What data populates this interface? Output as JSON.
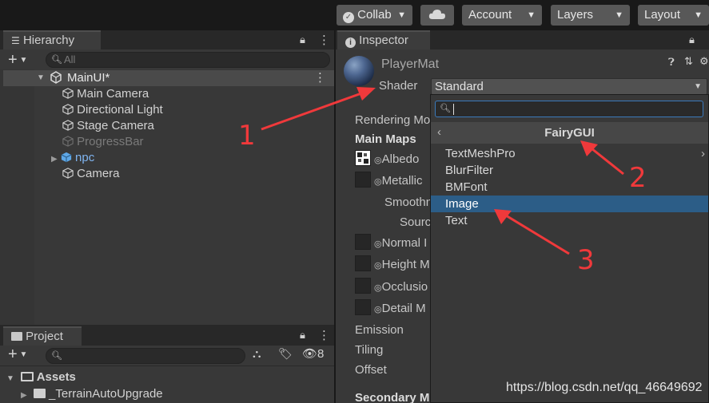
{
  "toolbar": {
    "collab_label": "Collab",
    "account_label": "Account",
    "layers_label": "Layers",
    "layout_label": "Layout"
  },
  "hierarchy": {
    "tab_label": "Hierarchy",
    "search_placeholder": "All",
    "scene_name": "MainUI*",
    "items": [
      {
        "label": "Main Camera"
      },
      {
        "label": "Directional Light"
      },
      {
        "label": "Stage Camera"
      },
      {
        "label": "ProgressBar"
      },
      {
        "label": "npc"
      },
      {
        "label": "Camera"
      }
    ]
  },
  "project": {
    "tab_label": "Project",
    "hidden_count": "8",
    "items": [
      {
        "label": "Assets"
      },
      {
        "label": "_TerrainAutoUpgrade"
      }
    ]
  },
  "inspector": {
    "tab_label": "Inspector",
    "material_name": "PlayerMat",
    "shader_label": "Shader",
    "shader_value": "Standard",
    "rows": {
      "rendering_mode": "Rendering Mo",
      "main_maps": "Main Maps",
      "albedo": "Albedo",
      "metallic": "Metallic",
      "smoothness": "Smoothn",
      "source": "Sourc",
      "normal": "Normal I",
      "height": "Height M",
      "occlusion": "Occlusio",
      "detail": "Detail M",
      "emission": "Emission",
      "tiling": "Tiling",
      "offset": "Offset",
      "secondary_maps": "Secondary M"
    }
  },
  "shader_menu": {
    "search_value": "",
    "header": "FairyGUI",
    "items": [
      {
        "label": "TextMeshPro",
        "submenu": true
      },
      {
        "label": "BlurFilter"
      },
      {
        "label": "BMFont"
      },
      {
        "label": "Image",
        "selected": true
      },
      {
        "label": "Text"
      }
    ]
  },
  "annotations": {
    "n1": "1",
    "n2": "2",
    "n3": "3",
    "color": "#f0393b"
  },
  "watermark": "https://blog.csdn.net/qq_46649692"
}
